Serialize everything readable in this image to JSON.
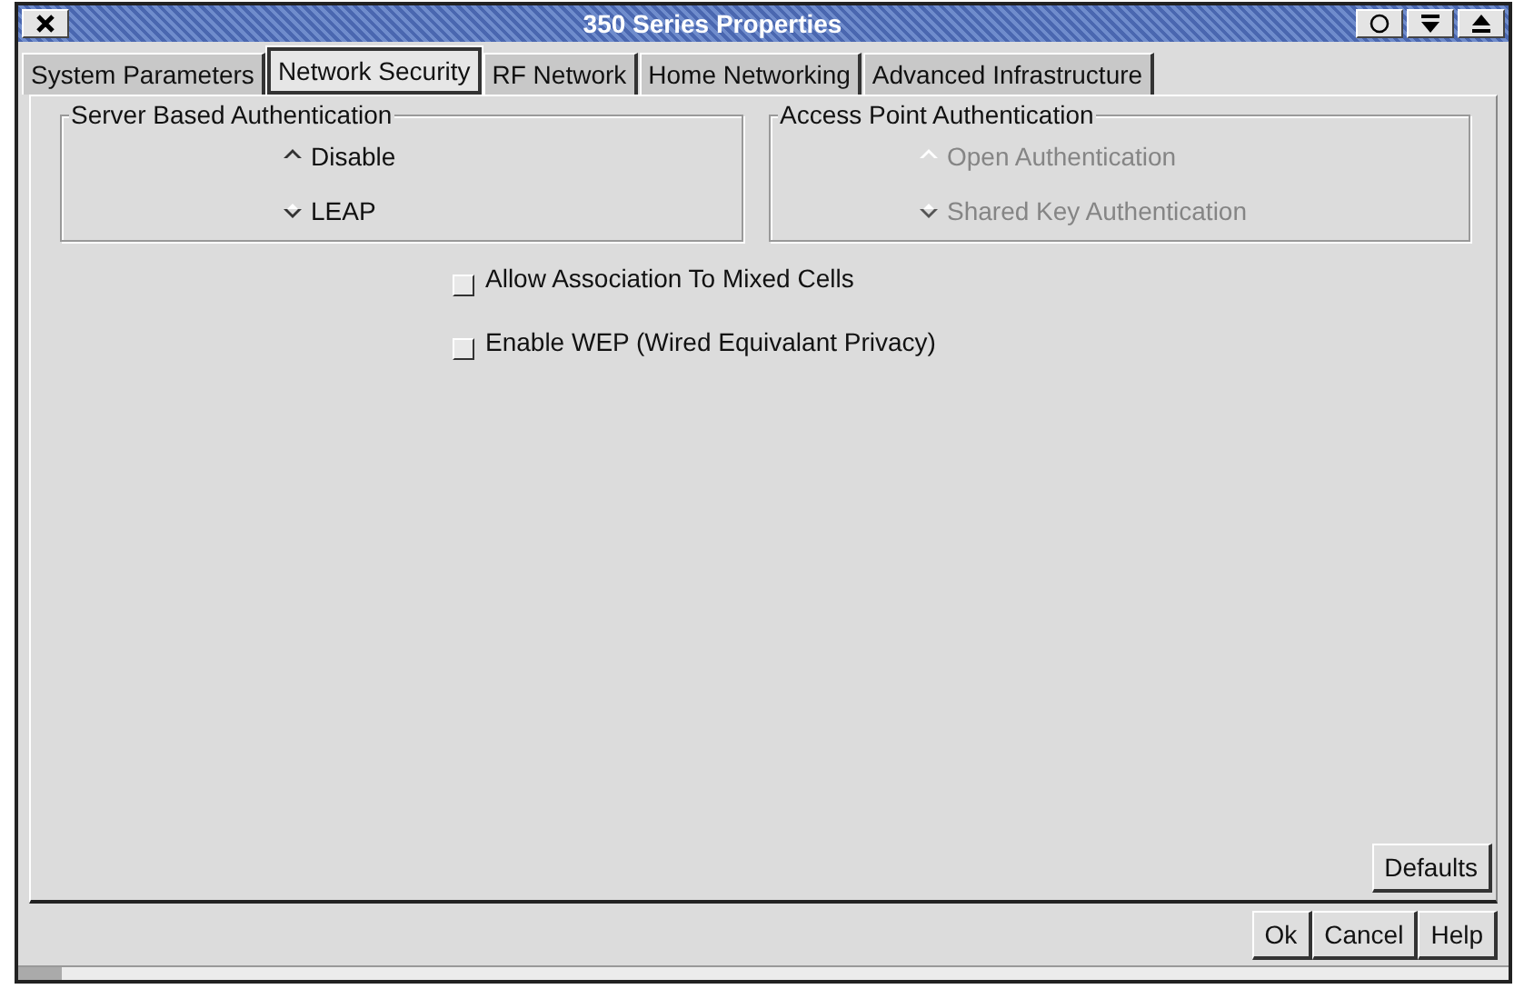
{
  "window": {
    "title": "350 Series Properties"
  },
  "tabs": [
    {
      "label": "System Parameters",
      "selected": false
    },
    {
      "label": "Network Security",
      "selected": true
    },
    {
      "label": "RF Network",
      "selected": false
    },
    {
      "label": "Home Networking",
      "selected": false
    },
    {
      "label": "Advanced Infrastructure",
      "selected": false
    }
  ],
  "groups": [
    {
      "title": "Server Based Authentication",
      "disabled": false,
      "options": [
        {
          "label": "Disable",
          "selected": true
        },
        {
          "label": "LEAP",
          "selected": false
        }
      ]
    },
    {
      "title": "Access Point Authentication",
      "disabled": true,
      "options": [
        {
          "label": "Open Authentication",
          "selected": true
        },
        {
          "label": "Shared Key Authentication",
          "selected": false
        }
      ]
    }
  ],
  "checkboxes": [
    {
      "label": "Allow Association To Mixed Cells",
      "checked": false
    },
    {
      "label": "Enable WEP (Wired Equivalant Privacy)",
      "checked": false
    }
  ],
  "defaults_button": "Defaults",
  "buttons": [
    "Ok",
    "Cancel",
    "Help"
  ]
}
